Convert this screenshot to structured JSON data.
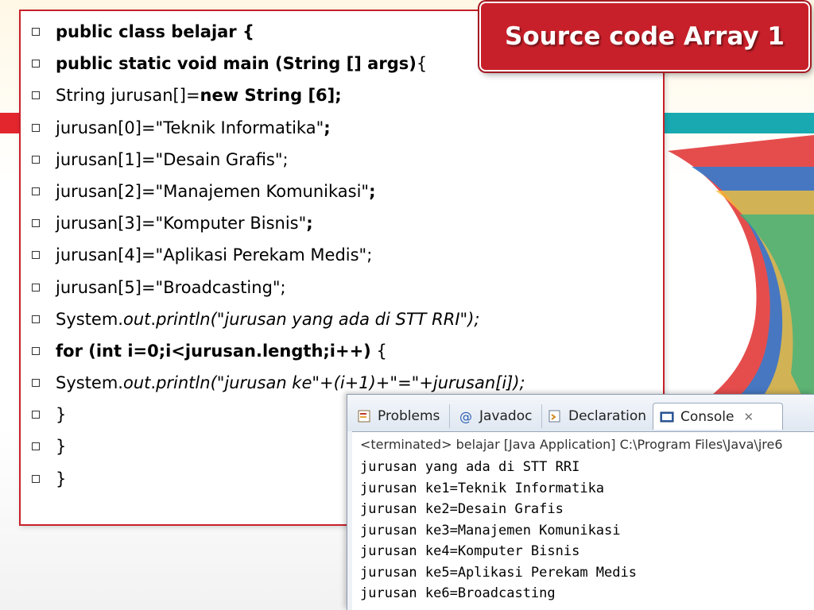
{
  "title": "Source code Array 1",
  "code_lines": [
    [
      {
        "t": "public class belajar {",
        "s": "b"
      }
    ],
    [
      {
        "t": "public static void main (String [] args)",
        "s": "b"
      },
      {
        "t": "{",
        "s": ""
      }
    ],
    [
      {
        "t": " String jurusan[]=",
        "s": ""
      },
      {
        "t": "new String [6];",
        "s": "b"
      }
    ],
    [
      {
        "t": " jurusan[0]=\"Teknik Informatika\"",
        "s": ""
      },
      {
        "t": ";",
        "s": "b"
      }
    ],
    [
      {
        "t": " jurusan[1]=\"Desain Grafis\";",
        "s": ""
      }
    ],
    [
      {
        "t": " jurusan[2]=\"Manajemen Komunikasi\"",
        "s": ""
      },
      {
        "t": ";",
        "s": "b"
      }
    ],
    [
      {
        "t": " jurusan[3]=\"Komputer Bisnis\"",
        "s": ""
      },
      {
        "t": ";",
        "s": "b"
      }
    ],
    [
      {
        "t": " jurusan[4]=\"Aplikasi Perekam Medis\";",
        "s": ""
      }
    ],
    [
      {
        "t": " jurusan[5]=\"Broadcasting\";",
        "s": ""
      }
    ],
    [
      {
        "t": " System.",
        "s": ""
      },
      {
        "t": "out",
        "s": "i"
      },
      {
        "t": ".",
        "s": ""
      },
      {
        "t": "println(\"jurusan yang ada di STT RRI\");",
        "s": "i"
      }
    ],
    [
      {
        "t": " for (int i=0;i<jurusan.length;i++)",
        "s": "b"
      },
      {
        "t": " {",
        "s": ""
      }
    ],
    [
      {
        "t": "     System.",
        "s": ""
      },
      {
        "t": "out",
        "s": "i"
      },
      {
        "t": ".",
        "s": ""
      },
      {
        "t": "println(\"jurusan ke\"+(i+1)+\"=\"+jurusan[i]);",
        "s": "i"
      }
    ],
    [
      {
        "t": " }",
        "s": ""
      }
    ],
    [
      {
        "t": "}",
        "s": ""
      }
    ],
    [
      {
        "t": "}",
        "s": ""
      }
    ]
  ],
  "console": {
    "tabs": [
      {
        "label": "Problems",
        "icon": "problems-icon"
      },
      {
        "label": "Javadoc",
        "icon": "javadoc-icon"
      },
      {
        "label": "Declaration",
        "icon": "declaration-icon"
      },
      {
        "label": "Console",
        "icon": "console-icon",
        "active": true
      }
    ],
    "close_glyph": "✕",
    "status": "<terminated> belajar [Java Application] C:\\Program Files\\Java\\jre6",
    "output": [
      "jurusan yang ada di STT RRI",
      "jurusan ke1=Teknik Informatika",
      "jurusan ke2=Desain Grafis",
      "jurusan ke3=Manajemen Komunikasi",
      "jurusan ke4=Komputer Bisnis",
      "jurusan ke5=Aplikasi Perekam Medis",
      "jurusan ke6=Broadcasting"
    ]
  },
  "colors": {
    "accent_red": "#c8202a",
    "accent_teal": "#18aab0"
  }
}
